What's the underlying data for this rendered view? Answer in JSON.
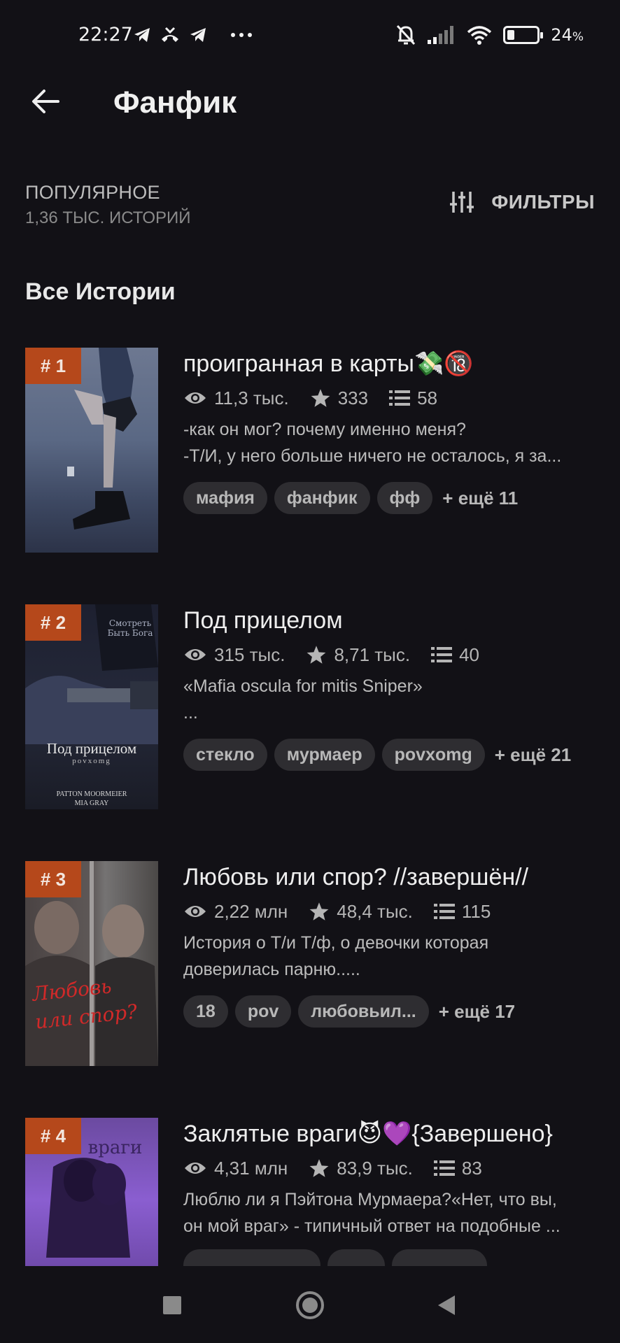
{
  "status_bar": {
    "time": "22:27",
    "battery_percent": "24",
    "battery_unit": "%",
    "battery_level": 0.24,
    "left_icons": [
      "telegram-icon",
      "missed-call-icon",
      "telegram-icon",
      "more-dots-icon"
    ],
    "right_icons": [
      "bell-muted-icon",
      "signal-icon",
      "wifi-icon",
      "battery-icon"
    ]
  },
  "header": {
    "title": "Фанфик"
  },
  "sort": {
    "title": "ПОПУЛЯРНОЕ",
    "count": "1,36 ТЫС. ИСТОРИЙ",
    "filters_label": "ФИЛЬТРЫ"
  },
  "section": {
    "title": "Все Истории"
  },
  "stories": [
    {
      "rank": "# 1",
      "title": "проигранная в карты💸🔞",
      "reads": "11,3 тыс.",
      "votes": "333",
      "parts": "58",
      "desc": [
        "-как он мог? почему именно меня?",
        "-Т/И, у него больше ничего не осталось, я за..."
      ],
      "tags": [
        "мафия",
        "фанфик",
        "фф"
      ],
      "more": "+ ещё 11"
    },
    {
      "rank": "# 2",
      "title": "Под прицелом",
      "reads": "315 тыс.",
      "votes": "8,71 тыс.",
      "parts": "40",
      "desc": [
        "«Mafia oscula for mitis Sniper»",
        "..."
      ],
      "tags": [
        "стекло",
        "мурмаер",
        "povxomg"
      ],
      "more": "+ ещё 21",
      "cover_text": {
        "title": "Под прицелом",
        "sub": "povxomg",
        "authors": "Patton Moormeier",
        "authors2": "Mia Gray",
        "top": "Смотреть Быть Бога"
      }
    },
    {
      "rank": "# 3",
      "title": "Любовь или спор?  //завершён//",
      "reads": "2,22 млн",
      "votes": "48,4 тыс.",
      "parts": "115",
      "desc": [
        "История о Т/и Т/ф, о девочки которая",
        "доверилась парню....."
      ],
      "tags": [
        "18",
        "pov",
        "любовьил..."
      ],
      "more": "+ ещё 17",
      "cover_text": {
        "title1": "Любовь",
        "title2": "или спор?"
      }
    },
    {
      "rank": "# 4",
      "title": "Заклятые враги😈💜{Завершено}",
      "reads": "4,31 млн",
      "votes": "83,9 тыс.",
      "parts": "83",
      "desc": [
        "Люблю ли я Пэйтона Мурмаера?«Нет, что вы,",
        "он мой враг» - типичный ответ на подобные ..."
      ],
      "tags": [],
      "more": "",
      "cover_text": {
        "title": "Заклятые враги"
      }
    }
  ],
  "nav": {
    "icons": [
      "recents-square-icon",
      "home-circle-icon",
      "back-triangle-icon"
    ]
  }
}
